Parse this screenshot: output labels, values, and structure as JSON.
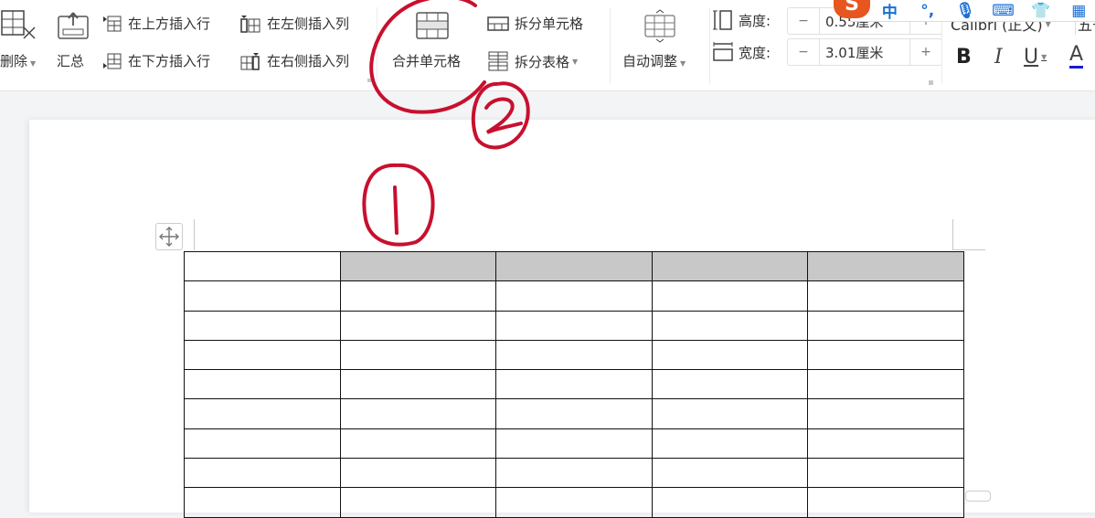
{
  "ribbon": {
    "delete_label": "删除",
    "summary_label": "汇总",
    "insert_row_above": "在上方插入行",
    "insert_row_below": "在下方插入行",
    "insert_col_left": "在左侧插入列",
    "insert_col_right": "在右侧插入列",
    "merge_cells": "合并单元格",
    "split_cells": "拆分单元格",
    "split_table": "拆分表格",
    "auto_fit": "自动调整",
    "height_label": "高度:",
    "height_value": "0.55厘米",
    "width_label": "宽度:",
    "width_value": "3.01厘米",
    "minus": "−",
    "plus": "+",
    "font_name": "Calibri (正文)",
    "font_size": "五号",
    "bold": "B",
    "italic": "I",
    "underline": "U",
    "font_color": "A",
    "font_color_hex": "#1a1adb"
  },
  "ime_toolbar": {
    "logo": "S",
    "mode": "中",
    "punct": "°,",
    "icons": [
      "mic-icon",
      "keyboard-icon",
      "skin-icon",
      "apps-icon"
    ]
  },
  "annotations": {
    "step1": "1",
    "step2": "2",
    "color": "#c8102e"
  },
  "table": {
    "rows": 9,
    "cols": 5,
    "selected_row": 0,
    "selected_cols": [
      1,
      2,
      3,
      4
    ],
    "selection_color": "#c8c8c8"
  }
}
